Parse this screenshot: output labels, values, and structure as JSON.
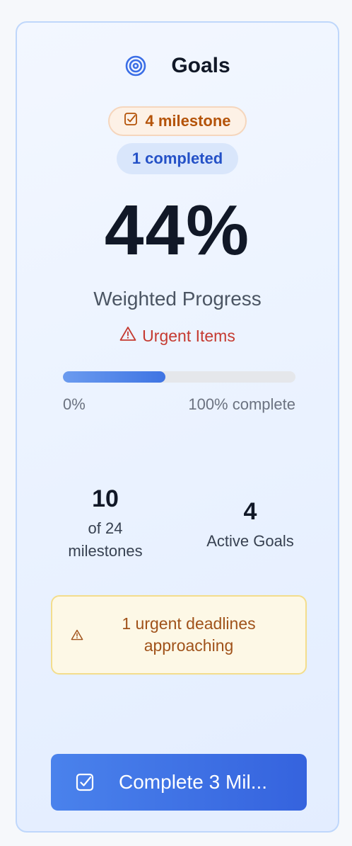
{
  "header": {
    "icon": "target-icon",
    "title": "Goals"
  },
  "badges": {
    "milestone_icon": "checkbox-icon",
    "milestone_label": "4 milestone",
    "completed_label": "1 completed"
  },
  "progress": {
    "percent_label": "44%",
    "fraction": 0.44,
    "subtitle": "Weighted Progress",
    "urgent_icon": "warning-icon",
    "urgent_label": "Urgent Items",
    "min_label": "0%",
    "max_label": "100% complete"
  },
  "stats": {
    "milestones_value": "10",
    "milestones_label_line1": "of 24",
    "milestones_label_line2": "milestones",
    "goals_value": "4",
    "goals_label": "Active Goals"
  },
  "alert": {
    "icon": "warning-icon",
    "text_line1": "1 urgent deadlines",
    "text_line2": "approaching"
  },
  "action": {
    "icon": "checkbox-icon",
    "label": "Complete 3 Mil..."
  },
  "colors": {
    "accent": "#3f74e3",
    "urgent": "#c53a31",
    "warning_text": "#a0521a",
    "milestone_text": "#b45309"
  }
}
